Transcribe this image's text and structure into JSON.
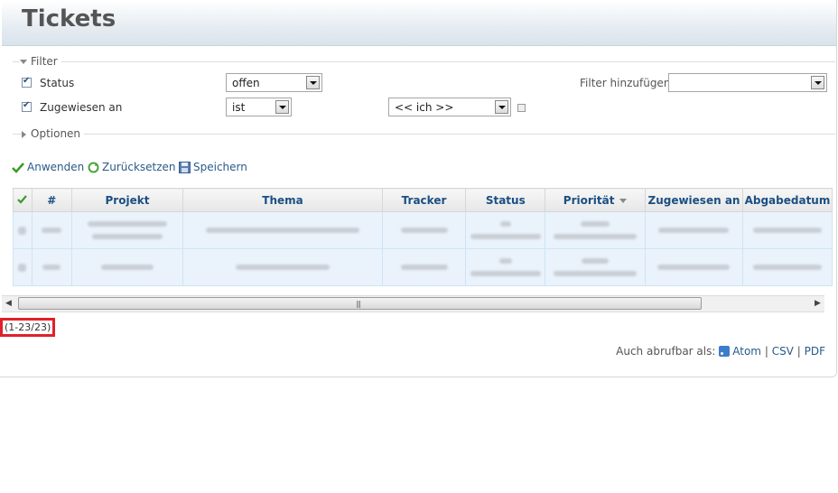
{
  "page": {
    "title": "Tickets"
  },
  "filter": {
    "legend": "Filter",
    "rows": [
      {
        "label": "Status",
        "operator": "offen"
      },
      {
        "label": "Zugewiesen an",
        "operator": "ist",
        "value": "<< ich >>"
      }
    ],
    "add_label": "Filter hinzufügen",
    "add_value": ""
  },
  "options": {
    "legend": "Optionen"
  },
  "actions": {
    "apply": "Anwenden",
    "reset": "Zurücksetzen",
    "save": "Speichern"
  },
  "table": {
    "columns": [
      "#",
      "Projekt",
      "Thema",
      "Tracker",
      "Status",
      "Priorität",
      "Zugewiesen an",
      "Abgabedatum"
    ]
  },
  "pagination": {
    "count": "(1-23/23)"
  },
  "export": {
    "label": "Auch abrufbar als:",
    "atom": "Atom",
    "csv": "CSV",
    "pdf": "PDF",
    "sep": "|"
  },
  "colors": {
    "link": "#2a5a8a",
    "header_text": "#1b4f82",
    "highlight_border": "#e0202b"
  }
}
